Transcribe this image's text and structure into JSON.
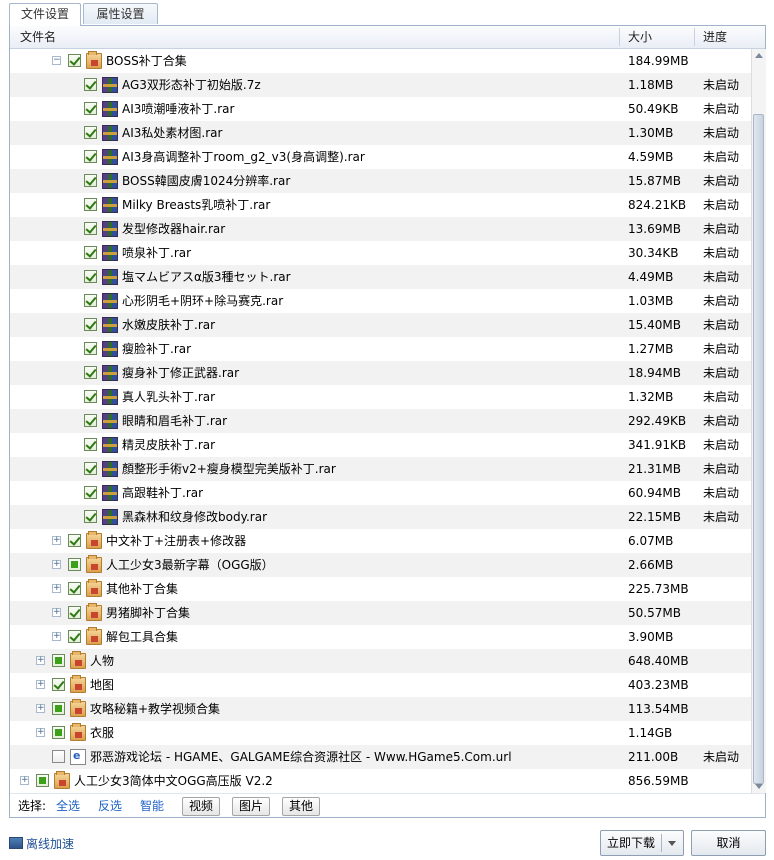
{
  "tabs": [
    "文件设置",
    "属性设置"
  ],
  "columns": {
    "name": "文件名",
    "size": "大小",
    "progress": "进度"
  },
  "rows": [
    {
      "level": 2,
      "expander": "-",
      "check": "checked",
      "icon": "folder",
      "name": "BOSS补丁合集",
      "size": "184.99MB",
      "progress": ""
    },
    {
      "level": 3,
      "expander": "",
      "check": "checked",
      "icon": "rar",
      "name": "AG3双形态补丁初始版.7z",
      "size": "1.18MB",
      "progress": "未启动"
    },
    {
      "level": 3,
      "expander": "",
      "check": "checked",
      "icon": "rar",
      "name": "AI3喷潮唾液补丁.rar",
      "size": "50.49KB",
      "progress": "未启动"
    },
    {
      "level": 3,
      "expander": "",
      "check": "checked",
      "icon": "rar",
      "name": "AI3私处素材图.rar",
      "size": "1.30MB",
      "progress": "未启动"
    },
    {
      "level": 3,
      "expander": "",
      "check": "checked",
      "icon": "rar",
      "name": "AI3身高调整补丁room_g2_v3(身高调整).rar",
      "size": "4.59MB",
      "progress": "未启动"
    },
    {
      "level": 3,
      "expander": "",
      "check": "checked",
      "icon": "rar",
      "name": "BOSS韓國皮膚1024分辨率.rar",
      "size": "15.87MB",
      "progress": "未启动"
    },
    {
      "level": 3,
      "expander": "",
      "check": "checked",
      "icon": "rar",
      "name": "Milky Breasts乳喷补丁.rar",
      "size": "824.21KB",
      "progress": "未启动"
    },
    {
      "level": 3,
      "expander": "",
      "check": "checked",
      "icon": "rar",
      "name": "发型修改器hair.rar",
      "size": "13.69MB",
      "progress": "未启动"
    },
    {
      "level": 3,
      "expander": "",
      "check": "checked",
      "icon": "rar",
      "name": "喷泉补丁.rar",
      "size": "30.34KB",
      "progress": "未启动"
    },
    {
      "level": 3,
      "expander": "",
      "check": "checked",
      "icon": "rar",
      "name": "塩マムビアスα版3種セット.rar",
      "size": "4.49MB",
      "progress": "未启动"
    },
    {
      "level": 3,
      "expander": "",
      "check": "checked",
      "icon": "rar",
      "name": "心形阴毛+阴环+除马赛克.rar",
      "size": "1.03MB",
      "progress": "未启动"
    },
    {
      "level": 3,
      "expander": "",
      "check": "checked",
      "icon": "rar",
      "name": "水嫩皮肤补丁.rar",
      "size": "15.40MB",
      "progress": "未启动"
    },
    {
      "level": 3,
      "expander": "",
      "check": "checked",
      "icon": "rar",
      "name": "瘦脸补丁.rar",
      "size": "1.27MB",
      "progress": "未启动"
    },
    {
      "level": 3,
      "expander": "",
      "check": "checked",
      "icon": "rar",
      "name": "瘦身补丁修正武器.rar",
      "size": "18.94MB",
      "progress": "未启动"
    },
    {
      "level": 3,
      "expander": "",
      "check": "checked",
      "icon": "rar",
      "name": "真人乳头补丁.rar",
      "size": "1.32MB",
      "progress": "未启动"
    },
    {
      "level": 3,
      "expander": "",
      "check": "checked",
      "icon": "rar",
      "name": "眼睛和眉毛补丁.rar",
      "size": "292.49KB",
      "progress": "未启动"
    },
    {
      "level": 3,
      "expander": "",
      "check": "checked",
      "icon": "rar",
      "name": "精灵皮肤补丁.rar",
      "size": "341.91KB",
      "progress": "未启动"
    },
    {
      "level": 3,
      "expander": "",
      "check": "checked",
      "icon": "rar",
      "name": "顏整形手術v2+瘦身模型完美版补丁.rar",
      "size": "21.31MB",
      "progress": "未启动"
    },
    {
      "level": 3,
      "expander": "",
      "check": "checked",
      "icon": "rar",
      "name": "高跟鞋补丁.rar",
      "size": "60.94MB",
      "progress": "未启动"
    },
    {
      "level": 3,
      "expander": "",
      "check": "checked",
      "icon": "rar",
      "name": "黑森林和纹身修改body.rar",
      "size": "22.15MB",
      "progress": "未启动"
    },
    {
      "level": 2,
      "expander": "+",
      "check": "checked",
      "icon": "folder",
      "name": "中文补丁+注册表+修改器",
      "size": "6.07MB",
      "progress": ""
    },
    {
      "level": 2,
      "expander": "+",
      "check": "partial",
      "icon": "folder",
      "name": "人工少女3最新字幕（OGG版）",
      "size": "2.66MB",
      "progress": ""
    },
    {
      "level": 2,
      "expander": "+",
      "check": "checked",
      "icon": "folder",
      "name": "其他补丁合集",
      "size": "225.73MB",
      "progress": ""
    },
    {
      "level": 2,
      "expander": "+",
      "check": "checked",
      "icon": "folder",
      "name": "男猪脚补丁合集",
      "size": "50.57MB",
      "progress": ""
    },
    {
      "level": 2,
      "expander": "+",
      "check": "checked",
      "icon": "folder",
      "name": "解包工具合集",
      "size": "3.90MB",
      "progress": ""
    },
    {
      "level": 1,
      "expander": "+",
      "check": "partial",
      "icon": "folder",
      "name": "人物",
      "size": "648.40MB",
      "progress": ""
    },
    {
      "level": 1,
      "expander": "+",
      "check": "checked",
      "icon": "folder",
      "name": "地图",
      "size": "403.23MB",
      "progress": ""
    },
    {
      "level": 1,
      "expander": "+",
      "check": "partial",
      "icon": "folder",
      "name": "攻略秘籍+教学视频合集",
      "size": "113.54MB",
      "progress": ""
    },
    {
      "level": 1,
      "expander": "+",
      "check": "partial",
      "icon": "folder",
      "name": "衣服",
      "size": "1.14GB",
      "progress": ""
    },
    {
      "level": 1,
      "expander": "",
      "check": "empty",
      "icon": "url",
      "name": "邪恶游戏论坛 - HGAME、GALGAME综合资源社区 - Www.HGame5.Com.url",
      "size": "211.00B",
      "progress": "未启动"
    },
    {
      "level": 0,
      "expander": "+",
      "check": "partial",
      "icon": "folder",
      "name": "人工少女3简体中文OGG高压版 V2.2",
      "size": "856.59MB",
      "progress": ""
    }
  ],
  "select_bar": {
    "label": "选择:",
    "links": [
      "全选",
      "反选",
      "智能"
    ],
    "buttons": [
      "视频",
      "图片",
      "其他"
    ]
  },
  "footer": {
    "offline_label": "离线加速",
    "download_label": "立即下载",
    "cancel_label": "取消"
  }
}
